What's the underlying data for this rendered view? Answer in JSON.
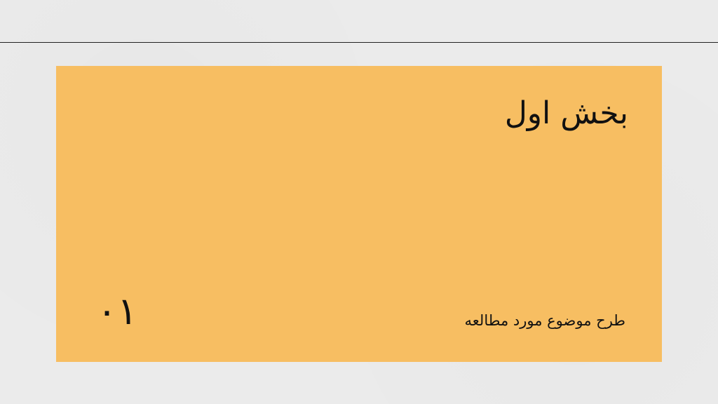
{
  "slide": {
    "title": "بخش اول",
    "number": "۰۱",
    "subtitle": "طرح موضوع مورد مطالعه"
  },
  "colors": {
    "background": "#ebebeb",
    "card": "#f7be62",
    "text": "#111111",
    "rule": "#222222"
  }
}
